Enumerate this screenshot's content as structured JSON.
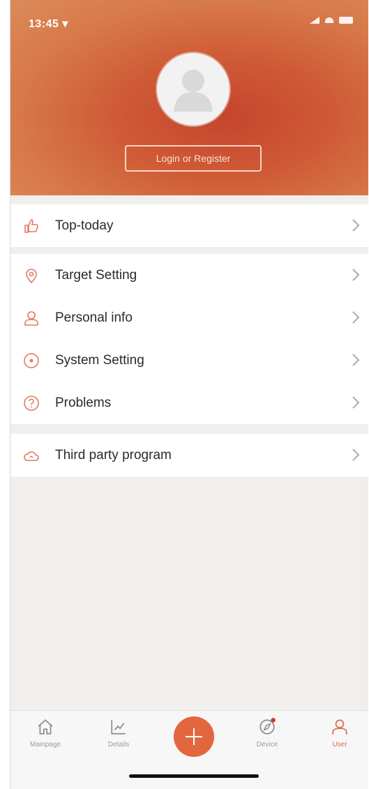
{
  "status_bar": {
    "time": "13:45 ▾"
  },
  "header": {
    "login_button": "Login or Register"
  },
  "menu_groups": [
    [
      {
        "label": "Top-today",
        "icon": "thumbs-up-icon"
      }
    ],
    [
      {
        "label": "Target Setting",
        "icon": "location-pin-icon"
      },
      {
        "label": "Personal info",
        "icon": "person-icon"
      },
      {
        "label": "System Setting",
        "icon": "settings-circle-icon"
      },
      {
        "label": "Problems",
        "icon": "question-circle-icon"
      }
    ],
    [
      {
        "label": "Third party program",
        "icon": "cloud-icon"
      }
    ]
  ],
  "tabbar": {
    "items": [
      {
        "label": "Mainpage",
        "icon": "home-icon"
      },
      {
        "label": "Details",
        "icon": "chart-icon"
      },
      {
        "label": "",
        "icon": "plus-icon"
      },
      {
        "label": "Device",
        "icon": "compass-icon"
      },
      {
        "label": "User",
        "icon": "user-icon"
      }
    ]
  },
  "colors": {
    "accent": "#e2673f",
    "header": "#c8502f",
    "icon": "#e07a62",
    "background": "#f0efed"
  }
}
